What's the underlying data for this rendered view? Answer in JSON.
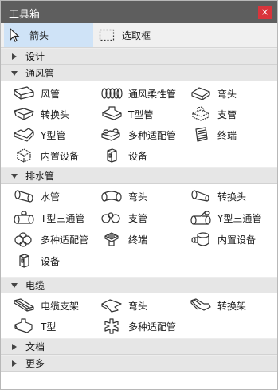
{
  "window": {
    "title": "工具箱",
    "close_label": "×"
  },
  "tools": {
    "arrow_label": "箭头",
    "marquee_label": "选取框"
  },
  "sections": {
    "design": "设计",
    "hvac": "通风管",
    "drain": "排水管",
    "cable": "电缆",
    "document": "文档",
    "more": "更多"
  },
  "hvac_items": [
    "风管",
    "通风柔性管",
    "弯头",
    "转换头",
    "T型管",
    "支管",
    "Y型管",
    "多种适配管",
    "终端",
    "内置设备",
    "设备"
  ],
  "drain_items": [
    "水管",
    "弯头",
    "转换头",
    "T型三通管",
    "支管",
    "Y型三通管",
    "多种适配管",
    "终端",
    "内置设备",
    "设备"
  ],
  "cable_items": [
    "电缆支架",
    "弯头",
    "转换架",
    "T型",
    "多种适配管"
  ]
}
